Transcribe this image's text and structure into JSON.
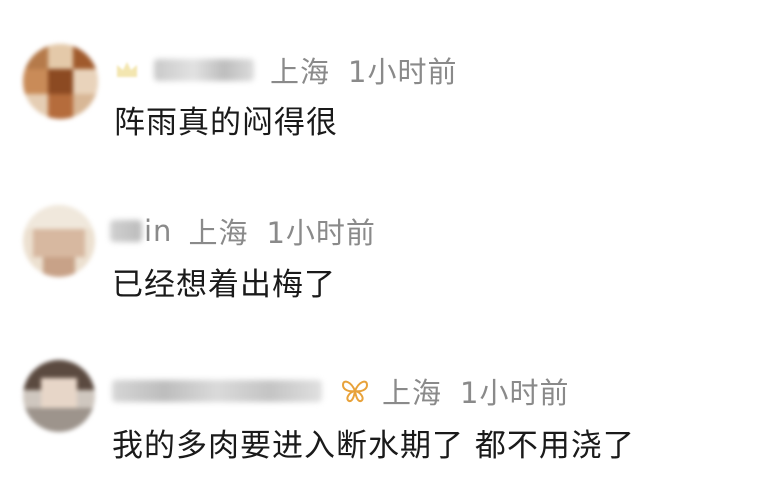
{
  "comments": [
    {
      "name_suffix": "",
      "location": "上海",
      "time": "1小时前",
      "text": "阵雨真的闷得很",
      "badge": "crown-icon"
    },
    {
      "name_suffix": "in",
      "location": "上海",
      "time": "1小时前",
      "text": "已经想着出梅了",
      "badge": ""
    },
    {
      "name_suffix": "",
      "location": "上海",
      "time": "1小时前",
      "text": "我的多肉要进入断水期了 都不用浇了",
      "badge": "butterfly-icon"
    }
  ],
  "colors": {
    "meta_gray": "#8a8a8a",
    "text_dark": "#1a1a1a",
    "badge_gold": "#e8a23a"
  }
}
